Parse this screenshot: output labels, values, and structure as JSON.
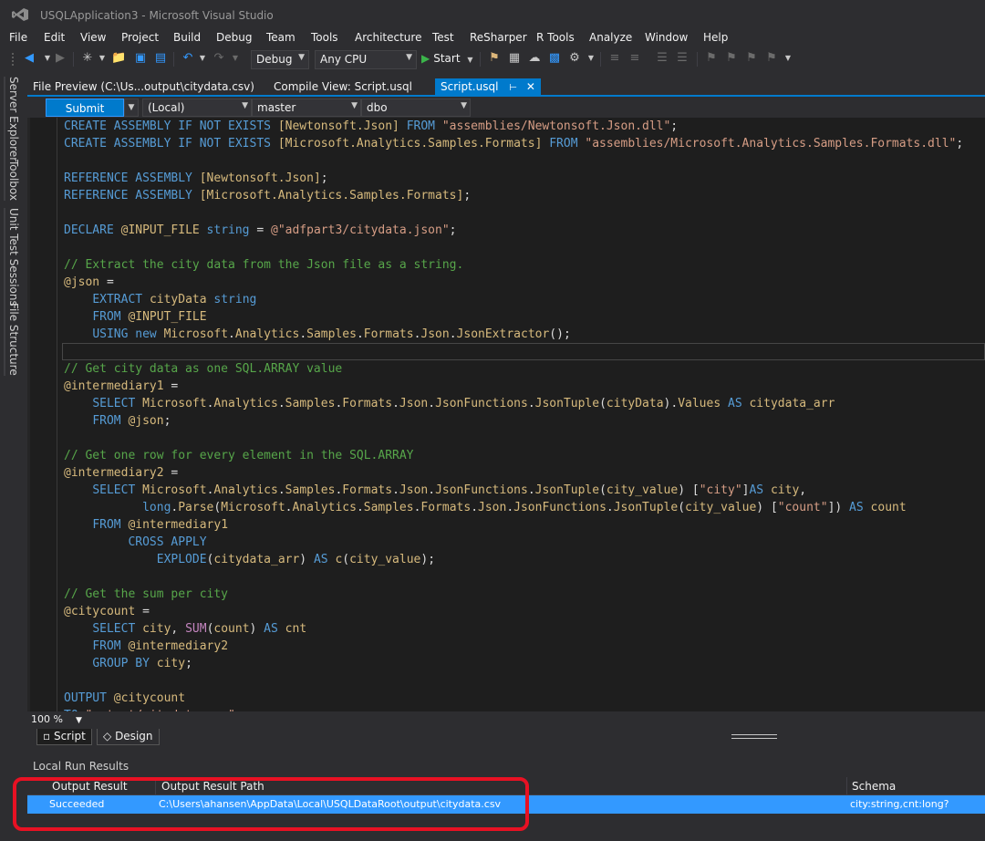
{
  "window": {
    "title": "USQLApplication3 - Microsoft Visual Studio"
  },
  "menu": [
    "File",
    "Edit",
    "View",
    "Project",
    "Build",
    "Debug",
    "Team",
    "Tools",
    "Architecture",
    "Test",
    "ReSharper",
    "R Tools",
    "Analyze",
    "Window",
    "Help"
  ],
  "toolbar": {
    "config": "Debug",
    "platform": "Any CPU",
    "start_label": "Start"
  },
  "sidebar_tabs": [
    "Server Explorer",
    "Toolbox",
    "Unit Test Sessions",
    "File Structure"
  ],
  "doc_tabs": [
    {
      "label": "File Preview (C:\\Us...output\\citydata.csv)"
    },
    {
      "label": "Compile View:  Script.usql"
    },
    {
      "label": "Script.usql",
      "active": true
    }
  ],
  "query_bar": {
    "submit_label": "Submit",
    "account": "(Local)",
    "database": "master",
    "schema": "dbo"
  },
  "editor": {
    "zoom": "100 %"
  },
  "view_tabs": {
    "script": "Script",
    "design": "Design"
  },
  "results": {
    "title": "Local Run Results",
    "columns": [
      "Output Result",
      "Output Result Path",
      "Schema"
    ],
    "row": {
      "result": "Succeeded",
      "path": "C:\\Users\\ahansen\\AppData\\Local\\USQLDataRoot\\output\\citydata.csv",
      "schema": "city:string,cnt:long?"
    }
  },
  "code_lines": [
    [
      [
        "k",
        "CREATE ASSEMBLY IF NOT EXISTS "
      ],
      [
        "t",
        "[Newtonsoft.Json]"
      ],
      [
        "k",
        " FROM "
      ],
      [
        "s",
        "\"assemblies/Newtonsoft.Json.dll\""
      ],
      [
        "n",
        ";"
      ]
    ],
    [
      [
        "k",
        "CREATE ASSEMBLY IF NOT EXISTS "
      ],
      [
        "t",
        "[Microsoft.Analytics.Samples.Formats]"
      ],
      [
        "k",
        " FROM "
      ],
      [
        "s",
        "\"assemblies/Microsoft.Analytics.Samples.Formats.dll\""
      ],
      [
        "n",
        ";"
      ]
    ],
    [],
    [
      [
        "k",
        "REFERENCE ASSEMBLY "
      ],
      [
        "t",
        "[Newtonsoft.Json]"
      ],
      [
        "n",
        ";"
      ]
    ],
    [
      [
        "k",
        "REFERENCE ASSEMBLY "
      ],
      [
        "t",
        "[Microsoft.Analytics.Samples.Formats]"
      ],
      [
        "n",
        ";"
      ]
    ],
    [],
    [
      [
        "k",
        "DECLARE "
      ],
      [
        "t",
        "@INPUT_FILE"
      ],
      [
        "k",
        " string"
      ],
      [
        "n",
        " = "
      ],
      [
        "s",
        "@\"adfpart3/citydata.json\""
      ],
      [
        "n",
        ";"
      ]
    ],
    [],
    [
      [
        "c",
        "// Extract the city data from the Json file as a string."
      ]
    ],
    [
      [
        "t",
        "@json"
      ],
      [
        "n",
        " ="
      ]
    ],
    [
      [
        "n",
        "    "
      ],
      [
        "k",
        "EXTRACT "
      ],
      [
        "t",
        "cityData"
      ],
      [
        "k",
        " string"
      ]
    ],
    [
      [
        "n",
        "    "
      ],
      [
        "k",
        "FROM "
      ],
      [
        "t",
        "@INPUT_FILE"
      ]
    ],
    [
      [
        "n",
        "    "
      ],
      [
        "k",
        "USING new "
      ],
      [
        "t",
        "Microsoft"
      ],
      [
        "n",
        "."
      ],
      [
        "t",
        "Analytics"
      ],
      [
        "n",
        "."
      ],
      [
        "t",
        "Samples"
      ],
      [
        "n",
        "."
      ],
      [
        "t",
        "Formats"
      ],
      [
        "n",
        "."
      ],
      [
        "t",
        "Json"
      ],
      [
        "n",
        "."
      ],
      [
        "t",
        "JsonExtractor"
      ],
      [
        "n",
        "();"
      ]
    ],
    [],
    [
      [
        "c",
        "// Get city data as one SQL.ARRAY value"
      ]
    ],
    [
      [
        "t",
        "@intermediary1"
      ],
      [
        "n",
        " ="
      ]
    ],
    [
      [
        "n",
        "    "
      ],
      [
        "k",
        "SELECT "
      ],
      [
        "t",
        "Microsoft"
      ],
      [
        "n",
        "."
      ],
      [
        "t",
        "Analytics"
      ],
      [
        "n",
        "."
      ],
      [
        "t",
        "Samples"
      ],
      [
        "n",
        "."
      ],
      [
        "t",
        "Formats"
      ],
      [
        "n",
        "."
      ],
      [
        "t",
        "Json"
      ],
      [
        "n",
        "."
      ],
      [
        "t",
        "JsonFunctions"
      ],
      [
        "n",
        "."
      ],
      [
        "t",
        "JsonTuple"
      ],
      [
        "n",
        "("
      ],
      [
        "t",
        "cityData"
      ],
      [
        "n",
        ")."
      ],
      [
        "t",
        "Values"
      ],
      [
        "k",
        " AS "
      ],
      [
        "t",
        "citydata_arr"
      ]
    ],
    [
      [
        "n",
        "    "
      ],
      [
        "k",
        "FROM "
      ],
      [
        "t",
        "@json"
      ],
      [
        "n",
        ";"
      ]
    ],
    [],
    [
      [
        "c",
        "// Get one row for every element in the SQL.ARRAY"
      ]
    ],
    [
      [
        "t",
        "@intermediary2"
      ],
      [
        "n",
        " ="
      ]
    ],
    [
      [
        "n",
        "    "
      ],
      [
        "k",
        "SELECT "
      ],
      [
        "t",
        "Microsoft"
      ],
      [
        "n",
        "."
      ],
      [
        "t",
        "Analytics"
      ],
      [
        "n",
        "."
      ],
      [
        "t",
        "Samples"
      ],
      [
        "n",
        "."
      ],
      [
        "t",
        "Formats"
      ],
      [
        "n",
        "."
      ],
      [
        "t",
        "Json"
      ],
      [
        "n",
        "."
      ],
      [
        "t",
        "JsonFunctions"
      ],
      [
        "n",
        "."
      ],
      [
        "t",
        "JsonTuple"
      ],
      [
        "n",
        "("
      ],
      [
        "t",
        "city_value"
      ],
      [
        "n",
        ") ["
      ],
      [
        "s",
        "\"city\""
      ],
      [
        "n",
        "]"
      ],
      [
        "k",
        "AS "
      ],
      [
        "t",
        "city"
      ],
      [
        "n",
        ","
      ]
    ],
    [
      [
        "n",
        "           "
      ],
      [
        "k",
        "long"
      ],
      [
        "n",
        "."
      ],
      [
        "t",
        "Parse"
      ],
      [
        "n",
        "("
      ],
      [
        "t",
        "Microsoft"
      ],
      [
        "n",
        "."
      ],
      [
        "t",
        "Analytics"
      ],
      [
        "n",
        "."
      ],
      [
        "t",
        "Samples"
      ],
      [
        "n",
        "."
      ],
      [
        "t",
        "Formats"
      ],
      [
        "n",
        "."
      ],
      [
        "t",
        "Json"
      ],
      [
        "n",
        "."
      ],
      [
        "t",
        "JsonFunctions"
      ],
      [
        "n",
        "."
      ],
      [
        "t",
        "JsonTuple"
      ],
      [
        "n",
        "("
      ],
      [
        "t",
        "city_value"
      ],
      [
        "n",
        ") ["
      ],
      [
        "s",
        "\"count\""
      ],
      [
        "n",
        "])"
      ],
      [
        "k",
        " AS "
      ],
      [
        "t",
        "count"
      ]
    ],
    [
      [
        "n",
        "    "
      ],
      [
        "k",
        "FROM "
      ],
      [
        "t",
        "@intermediary1"
      ]
    ],
    [
      [
        "n",
        "         "
      ],
      [
        "k",
        "CROSS APPLY"
      ]
    ],
    [
      [
        "n",
        "             "
      ],
      [
        "k",
        "EXPLODE"
      ],
      [
        "n",
        "("
      ],
      [
        "t",
        "citydata_arr"
      ],
      [
        "n",
        ")"
      ],
      [
        "k",
        " AS "
      ],
      [
        "t",
        "c"
      ],
      [
        "n",
        "("
      ],
      [
        "t",
        "city_value"
      ],
      [
        "n",
        ");"
      ]
    ],
    [],
    [
      [
        "c",
        "// Get the sum per city"
      ]
    ],
    [
      [
        "t",
        "@citycount"
      ],
      [
        "n",
        " ="
      ]
    ],
    [
      [
        "n",
        "    "
      ],
      [
        "k",
        "SELECT "
      ],
      [
        "t",
        "city"
      ],
      [
        "n",
        ", "
      ],
      [
        "pl",
        "SUM"
      ],
      [
        "n",
        "("
      ],
      [
        "t",
        "count"
      ],
      [
        "n",
        ")"
      ],
      [
        "k",
        " AS "
      ],
      [
        "t",
        "cnt"
      ]
    ],
    [
      [
        "n",
        "    "
      ],
      [
        "k",
        "FROM "
      ],
      [
        "t",
        "@intermediary2"
      ]
    ],
    [
      [
        "n",
        "    "
      ],
      [
        "k",
        "GROUP BY "
      ],
      [
        "t",
        "city"
      ],
      [
        "n",
        ";"
      ]
    ],
    [],
    [
      [
        "k",
        "OUTPUT "
      ],
      [
        "t",
        "@citycount"
      ]
    ],
    [
      [
        "k",
        "TO "
      ],
      [
        "s",
        "\"output/citydata.csv\""
      ]
    ]
  ]
}
